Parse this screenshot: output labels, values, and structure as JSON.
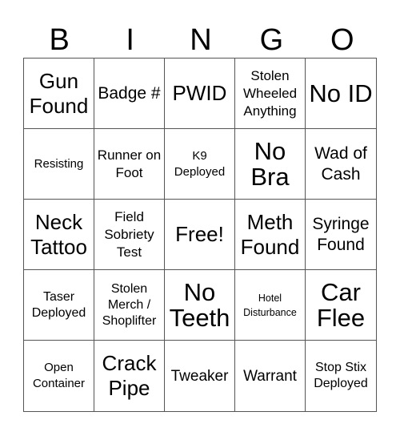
{
  "header": {
    "letters": [
      "B",
      "I",
      "N",
      "G",
      "O"
    ]
  },
  "cells": [
    {
      "text": "Gun Found",
      "size": "s-l"
    },
    {
      "text": "Badge #",
      "size": "s-m"
    },
    {
      "text": "PWID",
      "size": "s-l"
    },
    {
      "text": "Stolen Wheeled Anything",
      "size": "s-s"
    },
    {
      "text": "No ID",
      "size": "s-xl"
    },
    {
      "text": "Resisting",
      "size": "s-xxs"
    },
    {
      "text": "Runner on Foot",
      "size": "s-s"
    },
    {
      "text": "K9 Deployed",
      "size": "s-xxs"
    },
    {
      "text": "No Bra",
      "size": "s-xl"
    },
    {
      "text": "Wad of Cash",
      "size": "s-m"
    },
    {
      "text": "Neck Tattoo",
      "size": "s-l"
    },
    {
      "text": "Field Sobriety Test",
      "size": "s-s"
    },
    {
      "text": "Free!",
      "size": "s-l"
    },
    {
      "text": "Meth Found",
      "size": "s-l"
    },
    {
      "text": "Syringe Found",
      "size": "s-m"
    },
    {
      "text": "Taser Deployed",
      "size": "s-xs"
    },
    {
      "text": "Stolen Merch / Shoplifter",
      "size": "s-xs"
    },
    {
      "text": "No Teeth",
      "size": "s-xl"
    },
    {
      "text": "Hotel Disturbance",
      "size": "s-tiny"
    },
    {
      "text": "Car Flee",
      "size": "s-xl"
    },
    {
      "text": "Open Container",
      "size": "s-xxs"
    },
    {
      "text": "Crack Pipe",
      "size": "s-l"
    },
    {
      "text": "Tweaker",
      "size": "s-ms"
    },
    {
      "text": "Warrant",
      "size": "s-ms"
    },
    {
      "text": "Stop Stix Deployed",
      "size": "s-xs"
    }
  ]
}
